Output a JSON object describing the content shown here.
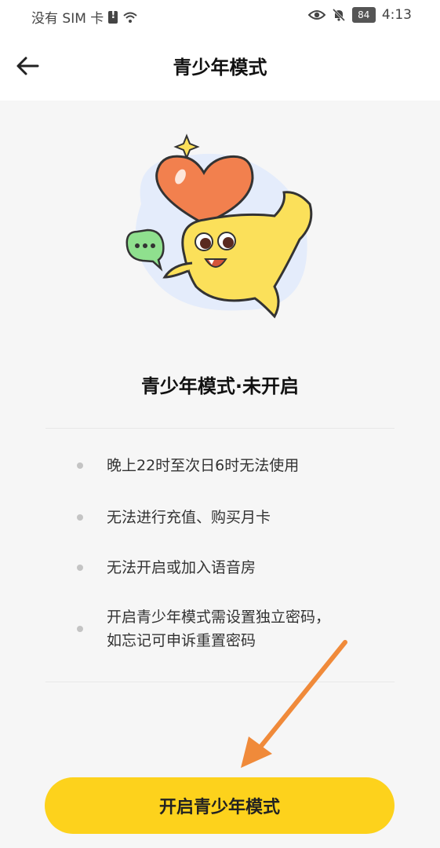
{
  "status_bar": {
    "carrier": "没有 SIM 卡",
    "battery": "84",
    "time": "4:13"
  },
  "header": {
    "title": "青少年模式",
    "back_icon": "arrow-left-icon"
  },
  "main": {
    "status_title": "青少年模式·未开启",
    "restrictions": [
      "晚上22时至次日6时无法使用",
      "无法进行充值、购买月卡",
      "无法开启或加入语音房",
      "开启青少年模式需设置独立密码，如忘记可申诉重置密码"
    ]
  },
  "footer": {
    "enable_button": "开启青少年模式"
  },
  "colors": {
    "button_bg": "#fdd21c",
    "mascot_yellow": "#fbe05a",
    "heart_orange": "#f2804e",
    "bubble_green": "#8fe08e",
    "annotation_arrow": "#f08a3a"
  }
}
